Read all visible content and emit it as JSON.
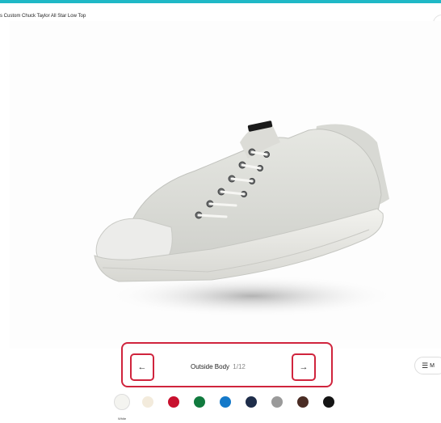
{
  "header": {
    "product_title": "s Custom Chuck Taylor All Star Low Top",
    "accent_color": "#1fb8c6"
  },
  "navigator": {
    "prev_icon": "←",
    "next_icon": "→",
    "section_label": "Outside Body",
    "section_count": "1/12",
    "highlight_color": "#d0243d"
  },
  "menu_button": {
    "icon": "☰",
    "label": "M"
  },
  "swatches": {
    "selected_label": "White",
    "colors": [
      "#f4f4f0",
      "#f3ebdc",
      "#c8102e",
      "#117a3e",
      "#1479c9",
      "#1e2d4a",
      "#9a9a9a",
      "#4a2c24",
      "#141414"
    ]
  }
}
